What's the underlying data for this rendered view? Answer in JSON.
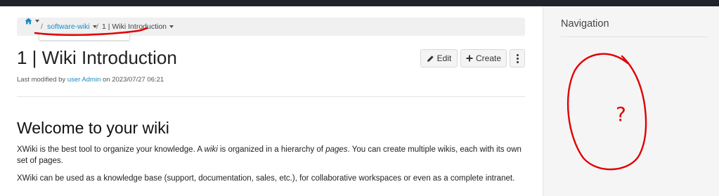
{
  "breadcrumb": {
    "items": [
      {
        "label": "software-wiki"
      },
      {
        "label": "1 | Wiki Introduction"
      }
    ],
    "separator": "/"
  },
  "page": {
    "title": "1 | Wiki Introduction",
    "meta": {
      "prefix": "Last modified by",
      "user": "user Admin",
      "date_prefix": "on",
      "date": "2023/07/27 06:21"
    }
  },
  "toolbar": {
    "edit_label": "Edit",
    "create_label": "Create"
  },
  "content": {
    "heading": "Welcome to your wiki",
    "paragraphs": [
      {
        "before_wiki": "XWiki is the best tool to organize your knowledge. A",
        "wiki": "wiki",
        "middle": "is organized in a hierarchy of",
        "pages": "pages",
        "after": ". You can create multiple wikis, each with its own set of pages."
      },
      {
        "text": "XWiki can be used as a knowledge base (support, documentation, sales, etc.), for collaborative workspaces or even as a complete intranet."
      }
    ]
  },
  "sidebar": {
    "title": "Navigation"
  },
  "annotation": {
    "mark": "?",
    "color": "#e00000"
  },
  "colors": {
    "link": "#1a8bc6",
    "topbar": "#20232b"
  }
}
